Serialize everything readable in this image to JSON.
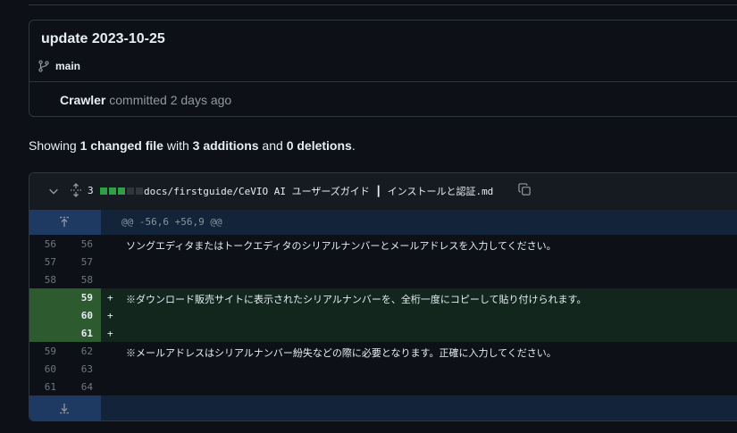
{
  "commit": {
    "title": "update 2023-10-25",
    "branch": "main",
    "author": "Crawler",
    "committed_text": "committed 2 days ago"
  },
  "summary": {
    "prefix": "Showing ",
    "files": "1 changed file",
    "with": " with ",
    "additions": "3 additions",
    "and": " and ",
    "deletions": "0 deletions",
    "end": "."
  },
  "file": {
    "change_count": "3",
    "path": "docs/firstguide/CeVIO AI ユーザーズガイド ┃ インストールと認証.md",
    "diffstat_colors": [
      "#2ea043",
      "#2ea043",
      "#2ea043",
      "#30363d",
      "#30363d"
    ],
    "hunk_header": "@@ -56,6 +56,9 @@",
    "lines": [
      {
        "old": "56",
        "new": "56",
        "sign": "",
        "type": "context",
        "text": "ソングエディタまたはトークエディタのシリアルナンバーとメールアドレスを入力してください。"
      },
      {
        "old": "57",
        "new": "57",
        "sign": "",
        "type": "context",
        "text": ""
      },
      {
        "old": "58",
        "new": "58",
        "sign": "",
        "type": "context",
        "text": ""
      },
      {
        "old": "",
        "new": "59",
        "sign": "+",
        "type": "add",
        "text": "※ダウンロード販売サイトに表示されたシリアルナンバーを、全桁一度にコピーして貼り付けられます。"
      },
      {
        "old": "",
        "new": "60",
        "sign": "+",
        "type": "add",
        "text": ""
      },
      {
        "old": "",
        "new": "61",
        "sign": "+",
        "type": "add",
        "text": ""
      },
      {
        "old": "59",
        "new": "62",
        "sign": "",
        "type": "context",
        "text": "※メールアドレスはシリアルナンバー紛失などの際に必要となります。正確に入力してください。"
      },
      {
        "old": "60",
        "new": "63",
        "sign": "",
        "type": "context",
        "text": ""
      },
      {
        "old": "61",
        "new": "64",
        "sign": "",
        "type": "context",
        "text": ""
      }
    ]
  },
  "icons": [
    "git-branch-icon",
    "chevron-down-icon",
    "unfold-icon",
    "copy-icon",
    "expand-up-icon",
    "expand-down-icon"
  ]
}
